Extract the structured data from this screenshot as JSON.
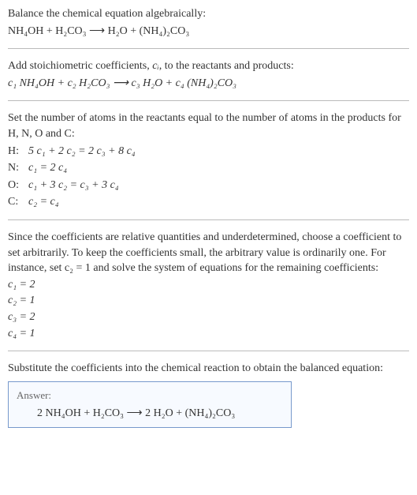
{
  "step1": {
    "text": "Balance the chemical equation algebraically:",
    "equation": "NH₄OH + H₂CO₃  ⟶  H₂O + (NH₄)₂CO₃"
  },
  "step2": {
    "text_before": "Add stoichiometric coefficients, ",
    "ci": "cᵢ",
    "text_after": ", to the reactants and products:",
    "equation": "c₁ NH₄OH + c₂ H₂CO₃  ⟶  c₃ H₂O + c₄ (NH₄)₂CO₃"
  },
  "step3": {
    "text": "Set the number of atoms in the reactants equal to the number of atoms in the products for H, N, O and C:",
    "rows": [
      {
        "label": "H:",
        "expr": "5 c₁ + 2 c₂ = 2 c₃ + 8 c₄"
      },
      {
        "label": "N:",
        "expr": "c₁ = 2 c₄"
      },
      {
        "label": "O:",
        "expr": "c₁ + 3 c₂ = c₃ + 3 c₄"
      },
      {
        "label": "C:",
        "expr": "c₂ = c₄"
      }
    ]
  },
  "step4": {
    "text": "Since the coefficients are relative quantities and underdetermined, choose a coefficient to set arbitrarily. To keep the coefficients small, the arbitrary value is ordinarily one. For instance, set c₂ = 1 and solve the system of equations for the remaining coefficients:",
    "coefs": [
      "c₁ = 2",
      "c₂ = 1",
      "c₃ = 2",
      "c₄ = 1"
    ]
  },
  "step5": {
    "text": "Substitute the coefficients into the chemical reaction to obtain the balanced equation:",
    "answer_label": "Answer:",
    "answer_eq": "2 NH₄OH + H₂CO₃  ⟶  2 H₂O + (NH₄)₂CO₃"
  }
}
